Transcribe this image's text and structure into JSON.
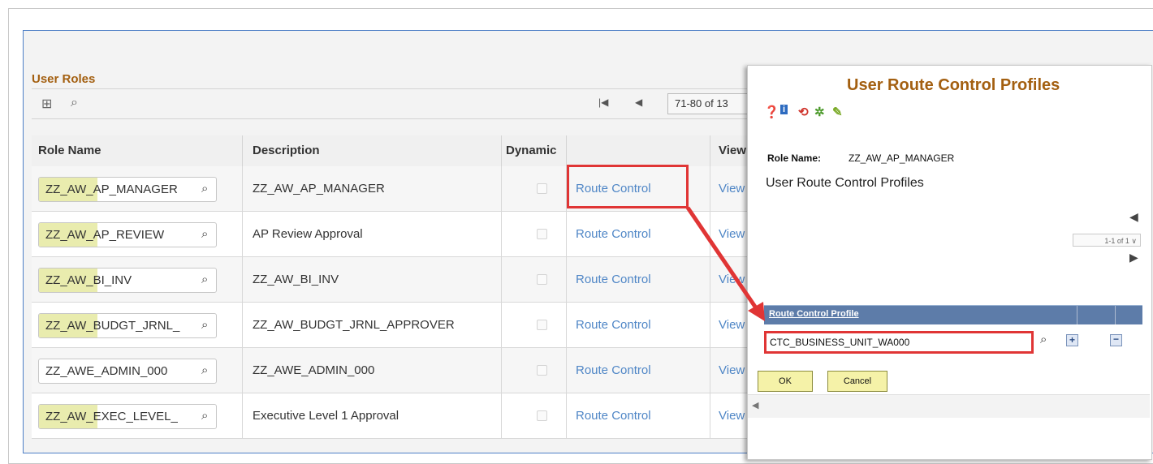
{
  "grid": {
    "title": "User Roles",
    "pager_range": "71-80 of 13",
    "columns": {
      "role_name": "Role Name",
      "description": "Description",
      "dynamic": "Dynamic",
      "view": "View"
    },
    "rows": [
      {
        "role": "ZZ_AW_AP_MANAGER",
        "description": "ZZ_AW_AP_MANAGER",
        "route": "Route Control",
        "view": "View"
      },
      {
        "role": "ZZ_AW_AP_REVIEW",
        "description": "AP Review Approval",
        "route": "Route Control",
        "view": "View"
      },
      {
        "role": "ZZ_AW_BI_INV",
        "description": "ZZ_AW_BI_INV",
        "route": "Route Control",
        "view": "View"
      },
      {
        "role": "ZZ_AW_BUDGT_JRNL_",
        "description": "ZZ_AW_BUDGT_JRNL_APPROVER",
        "route": "Route Control",
        "view": "View"
      },
      {
        "role": "ZZ_AWE_ADMIN_000",
        "description": "ZZ_AWE_ADMIN_000",
        "route": "Route Control",
        "view": "View"
      },
      {
        "role": "ZZ_AW_EXEC_LEVEL_",
        "description": "Executive Level 1 Approval",
        "route": "Route Control",
        "view": "View"
      }
    ]
  },
  "modal": {
    "title": "User Route Control Profiles",
    "role_label": "Role Name:",
    "role_value": "ZZ_AW_AP_MANAGER",
    "section_heading": "User Route Control Profiles",
    "pager_select": "1-1 of 1",
    "grid_header": "Route Control Profile",
    "profile_value": "CTC_BUSINESS_UNIT_WA000",
    "ok_label": "OK",
    "cancel_label": "Cancel"
  },
  "colors": {
    "accent_orange": "#a35f10",
    "link_blue": "#4f86c6",
    "highlight_red": "#e03535",
    "button_yellow": "#f5f2a8"
  }
}
